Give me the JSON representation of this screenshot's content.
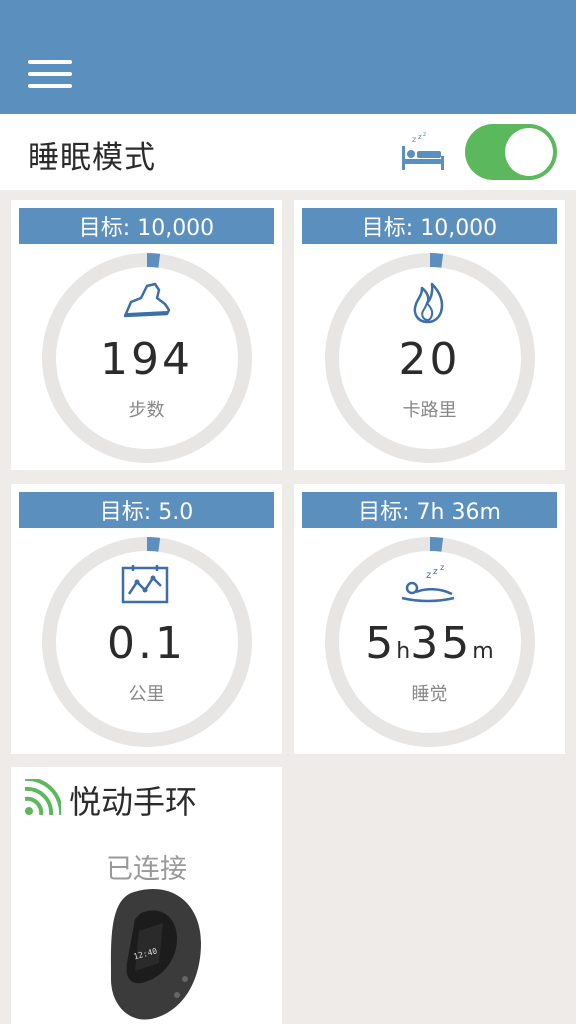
{
  "header": {
    "menu_icon": "hamburger-menu-icon"
  },
  "sleep_mode": {
    "title": "睡眠模式",
    "icon": "bed-icon",
    "enabled": true
  },
  "colors": {
    "header": "#5b8fbe",
    "toggle_on": "#5cb85c",
    "ring_track": "#e8e6e4",
    "ring_progress": "#5b8fbe"
  },
  "cards": [
    {
      "goal": "目标: 10,000",
      "value": "194",
      "label": "步数",
      "icon": "shoe-icon",
      "progress": 0.02
    },
    {
      "goal": "目标: 10,000",
      "value": "20",
      "label": "卡路里",
      "icon": "flame-icon",
      "progress": 0.02
    },
    {
      "goal": "目标: 5.0",
      "value": "0.1",
      "label": "公里",
      "icon": "distance-chart-icon",
      "progress": 0.02
    },
    {
      "goal": "目标: 7h 36m",
      "value_h": "5",
      "unit_h": "h",
      "value_m": "35",
      "unit_m": "m",
      "label": "睡觉",
      "icon": "sleeping-person-icon",
      "progress": 0.02
    }
  ],
  "device": {
    "title": "悦动手环",
    "status": "已连接",
    "icon": "signal-icon",
    "screen_time": "12:40"
  }
}
